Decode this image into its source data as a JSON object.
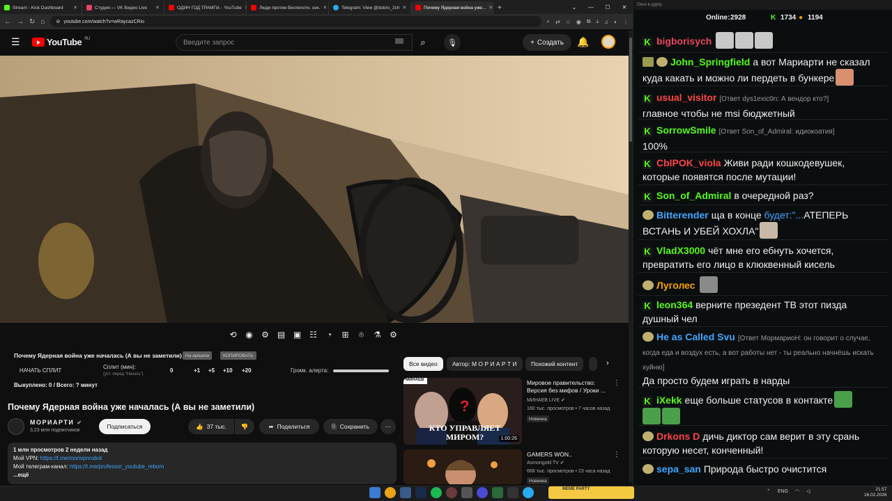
{
  "browser": {
    "tabs": [
      {
        "label": "Stream - Kick Dashboard",
        "color": "#53fc18"
      },
      {
        "label": "Студия — VK Видео Live",
        "color": "#e94560"
      },
      {
        "label": "ОДИН ГОД ТРАМПА - YouTube",
        "color": "#ff0000"
      },
      {
        "label": "Люди против беспилотн. сек.",
        "color": "#ff0000"
      },
      {
        "label": "Telegram: View @dobro_2ch",
        "color": "#2aabee"
      },
      {
        "label": "Почему Ядерная война уже...",
        "color": "#ff0000"
      }
    ],
    "url": "youtube.com/watch?v=wRaycazCRio"
  },
  "youtube": {
    "region": "RU",
    "logo_text": "YouTube",
    "search_placeholder": "Введите запрос",
    "create_label": "Создать"
  },
  "plugin": {
    "title": "Почему Ядерная война уже началась (А вы не заметили)",
    "pill1": "На аукцион",
    "pill2": "КОПИРОВАТЬ",
    "split_start": "НАЧАТЬ СПЛИТ",
    "split_min": "Сплит (мин):",
    "split_sub": "(уст. перед \"Начать\")",
    "values": [
      "0",
      "+1",
      "+5",
      "+10",
      "+20"
    ],
    "alert_label": "Громк. алерта:",
    "bought": "Выкуплено: 0 / Всего: ? минут"
  },
  "video": {
    "title": "Почему Ядерная война уже началась (А вы не заметили)",
    "channel": "МОРИАРТИ",
    "subscribers": "3,23 млн подписчиков",
    "subscribe_label": "Подписаться",
    "likes": "37 тыс.",
    "share_label": "Поделиться",
    "save_label": "Сохранить",
    "desc_stats": "1 млн просмотров  2 недели назад",
    "desc_vpn_label": "Мой VPN: ",
    "desc_vpn_link": "https://t.me/morivpnrobot",
    "desc_tg_label": "Мой телеграм-канал: ",
    "desc_tg_link": "https://t.me/professor_youtube_reborn",
    "desc_more": "...ещё"
  },
  "related": {
    "chips": [
      "Все видео",
      "Автор: М О Р И А Р Т И",
      "Похожий контент"
    ],
    "items": [
      {
        "title": "Мировое правительство: Версия без мифов / Уроки ...",
        "channel": "МИНАЕВ LIVE",
        "meta": "160 тыс. просмотров  •  7 часов назад",
        "badge": "Новинка",
        "duration": "1:00:26",
        "thumb_text": "КТО УПРАВЛЯЕТ МИРОМ?",
        "thumb_brand": "МИНАЕВ"
      },
      {
        "title": "GAMERS WON..",
        "channel": "Asmongold TV",
        "meta": "668 тыс. просмотров  •  23 часа назад",
        "badge": "Новинка"
      }
    ]
  },
  "chat": {
    "window_title": "Окно в дурку",
    "online_label": "Online:",
    "online": "2928",
    "count1": "1734",
    "count2": "1194",
    "messages": [
      {
        "user": "bigborisych",
        "color": "#e94560",
        "text": ""
      },
      {
        "user": "John_Springfield",
        "color": "#53fc18",
        "text": "а вот Мариарти не сказал куда какать и можно ли пердеть в бункере"
      },
      {
        "user": "usual_visitor",
        "color": "#ff4444",
        "reply": "[Ответ dys1exic0n: А вендор кто?]",
        "text": "главное чтобы не msi бюджетный"
      },
      {
        "user": "SorrowSmile",
        "color": "#53fc18",
        "reply": "[Ответ Son_of_Admiral: идиокоатия]",
        "text": "100%"
      },
      {
        "user": "CbIPOK_viola",
        "color": "#ff4444",
        "text": "Живи ради кошкодевушек, которые появятся после мутации!"
      },
      {
        "user": "Son_of_Admiral",
        "color": "#53fc18",
        "text": "в очередной раз?"
      },
      {
        "user": "Bitterender",
        "color": "#3ea6ff",
        "text_pre": "ща в конце ",
        "text_link": "будет:\"...",
        "text": "АТЕПЕРЬ ВСТАНЬ И УБЕЙ ХОХЛА\""
      },
      {
        "user": "VladX3000",
        "color": "#53fc18",
        "text": "чёт мне его ебнуть хочется, превратить его лицо в клюквенный кисель"
      },
      {
        "user": "Луголес",
        "color": "#f7a200",
        "text": ""
      },
      {
        "user": "leon364",
        "color": "#53fc18",
        "text": "верните презедент ТВ этот пизда душный чел"
      },
      {
        "user": "He as Called Svu",
        "color": "#3ea6ff",
        "reply": "[Ответ МормариоН: он говорит о случае, когда еда и воздух есть, а вот работы нет - ты реально начнёшь искать хуйню]",
        "text": "Да просто будем играть в нарды"
      },
      {
        "user": "iXekk",
        "color": "#53fc18",
        "text": "еще больше статусов в контакте"
      },
      {
        "user": "Drkons D",
        "color": "#ff4444",
        "text": "дичь диктор сам верит в эту срань которую несет, конченный!"
      },
      {
        "user": "sepa_san",
        "color": "#3ea6ff",
        "text": "Природа быстро очистится"
      }
    ]
  },
  "taskbar": {
    "meme_label": "MEME PARTY",
    "lang": "ENG",
    "time": "21:57",
    "date": "16.02.2026"
  }
}
